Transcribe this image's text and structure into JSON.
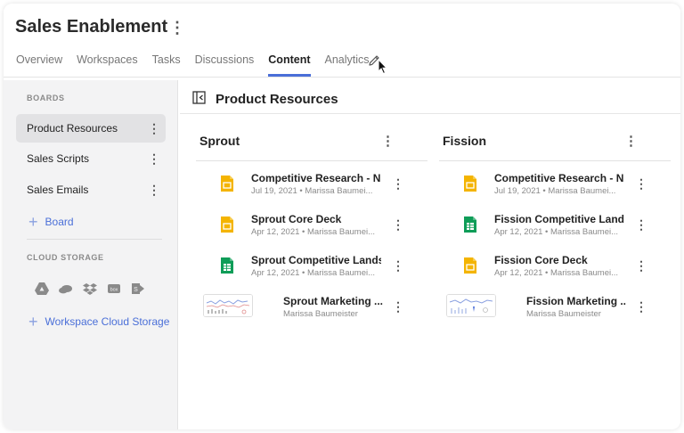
{
  "header": {
    "title": "Sales Enablement",
    "tabs": [
      {
        "label": "Overview"
      },
      {
        "label": "Workspaces"
      },
      {
        "label": "Tasks"
      },
      {
        "label": "Discussions"
      },
      {
        "label": "Content",
        "active": true
      },
      {
        "label": "Analytics"
      }
    ]
  },
  "sidebar": {
    "boards_label": "BOARDS",
    "boards": [
      {
        "label": "Product Resources",
        "active": true
      },
      {
        "label": "Sales Scripts"
      },
      {
        "label": "Sales Emails"
      }
    ],
    "add_board_label": "Board",
    "cloud_label": "CLOUD STORAGE",
    "cloud_icons": [
      "google-drive-icon",
      "onedrive-icon",
      "dropbox-icon",
      "box-icon",
      "sharepoint-icon"
    ],
    "add_cloud_label": "Workspace Cloud Storage"
  },
  "main": {
    "title": "Product Resources",
    "columns": [
      {
        "title": "Sprout",
        "items": [
          {
            "name": "Competitive Research - N...",
            "meta": "Jul 19, 2021 • Marissa Baumei...",
            "icon": "google-slides-icon"
          },
          {
            "name": "Sprout Core Deck",
            "meta": "Apr 12, 2021 • Marissa Baumei...",
            "icon": "google-slides-icon"
          },
          {
            "name": "Sprout Competitive Lands...",
            "meta": "Apr 12, 2021 • Marissa Baumei...",
            "icon": "google-sheets-icon"
          },
          {
            "name": "Sprout Marketing ...",
            "meta": "Marissa Baumeister",
            "icon": "dashboard-thumbnail"
          }
        ]
      },
      {
        "title": "Fission",
        "items": [
          {
            "name": "Competitive Research - N...",
            "meta": "Jul 19, 2021 • Marissa Baumei...",
            "icon": "google-slides-icon"
          },
          {
            "name": "Fission Competitive Land...",
            "meta": "Apr 12, 2021 • Marissa Baumei...",
            "icon": "google-sheets-icon"
          },
          {
            "name": "Fission Core Deck",
            "meta": "Apr 12, 2021 • Marissa Baumei...",
            "icon": "google-slides-icon"
          },
          {
            "name": "Fission Marketing ...",
            "meta": "Marissa Baumeister",
            "icon": "dashboard-thumbnail"
          }
        ]
      }
    ]
  },
  "colors": {
    "accent": "#4a6fd8",
    "slides": "#f4b400",
    "sheets": "#0f9d58",
    "sidebar_bg": "#f3f3f4"
  }
}
